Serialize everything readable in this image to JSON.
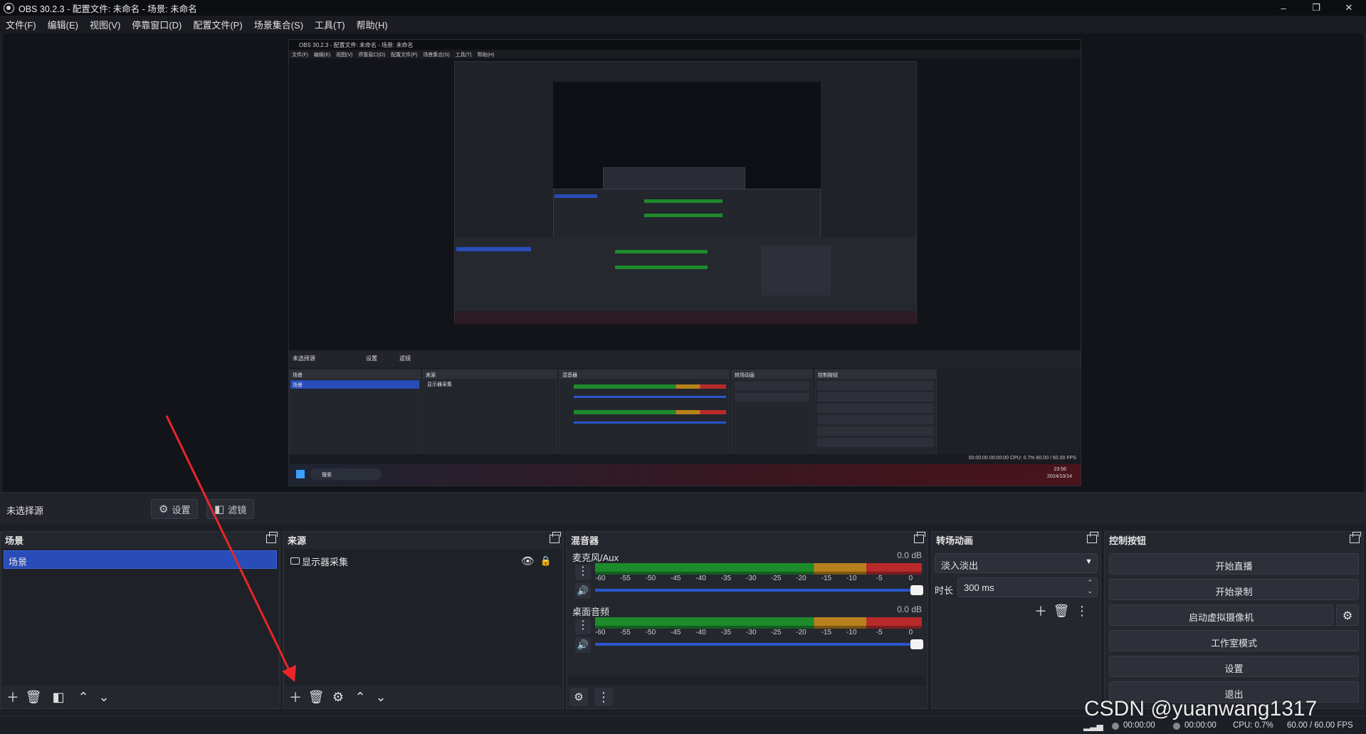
{
  "window": {
    "title": "OBS 30.2.3 - 配置文件: 未命名 - 场景: 未命名",
    "minimize": "–",
    "maximize": "❐",
    "close": "✕"
  },
  "menu": [
    "文件(F)",
    "编辑(E)",
    "视图(V)",
    "停靠窗口(D)",
    "配置文件(P)",
    "场景集合(S)",
    "工具(T)",
    "帮助(H)"
  ],
  "nested": {
    "title": "OBS 30.2.3 - 配置文件: 未命名 - 场景: 未命名",
    "menu": "文件(F) 编辑(E) 视图(V) 停靠窗口(D) 配置文件(P) 场景集合(S) 工具(T) 帮助(H)",
    "nosel": "未选择源",
    "settings": "设置",
    "filters": "滤镜",
    "scenes_title": "场景",
    "scene_item": "场景",
    "sources_title": "来源",
    "source_item": "显示器采集",
    "mixer_title": "混音器",
    "transitions_title": "转场动画",
    "controls_title": "控制按钮",
    "status": "00:00:00   00:00:00   CPU: 0.7%   60.00 / 60.00 FPS",
    "search": "搜索",
    "clock": "23:56",
    "date": "2024/10/14"
  },
  "source_toolbar": {
    "no_source": "未选择源",
    "settings": "设置",
    "filters": "滤镜"
  },
  "scenes": {
    "title": "场景",
    "items": [
      "场景"
    ]
  },
  "sources": {
    "title": "来源",
    "items": [
      "显示器采集"
    ]
  },
  "mixer": {
    "title": "混音器",
    "channels": [
      {
        "name": "麦克风/Aux",
        "db": "0.0 dB",
        "volume_percent": 100
      },
      {
        "name": "桌面音频",
        "db": "0.0 dB",
        "volume_percent": 100
      }
    ],
    "ticks": [
      "-60",
      "-55",
      "-50",
      "-45",
      "-40",
      "-35",
      "-30",
      "-25",
      "-20",
      "-15",
      "-10",
      "-5",
      "0"
    ]
  },
  "transitions": {
    "title": "转场动画",
    "selected": "淡入淡出",
    "duration_label": "时长",
    "duration": "300 ms"
  },
  "controls": {
    "title": "控制按钮",
    "buttons": [
      "开始直播",
      "开始录制",
      "启动虚拟摄像机",
      "工作室模式",
      "设置",
      "退出"
    ]
  },
  "status": {
    "time1": "00:00:00",
    "time2": "00:00:00",
    "cpu": "CPU: 0.7%",
    "fps": "60.00 / 60.00 FPS"
  },
  "watermark": "CSDN @yuanwang1317",
  "colors": {
    "accent": "#284cb8",
    "arrow": "#e8262a",
    "meter_green": "#1d8a2b",
    "meter_yellow": "#b8801c",
    "meter_red": "#b82a2a"
  }
}
